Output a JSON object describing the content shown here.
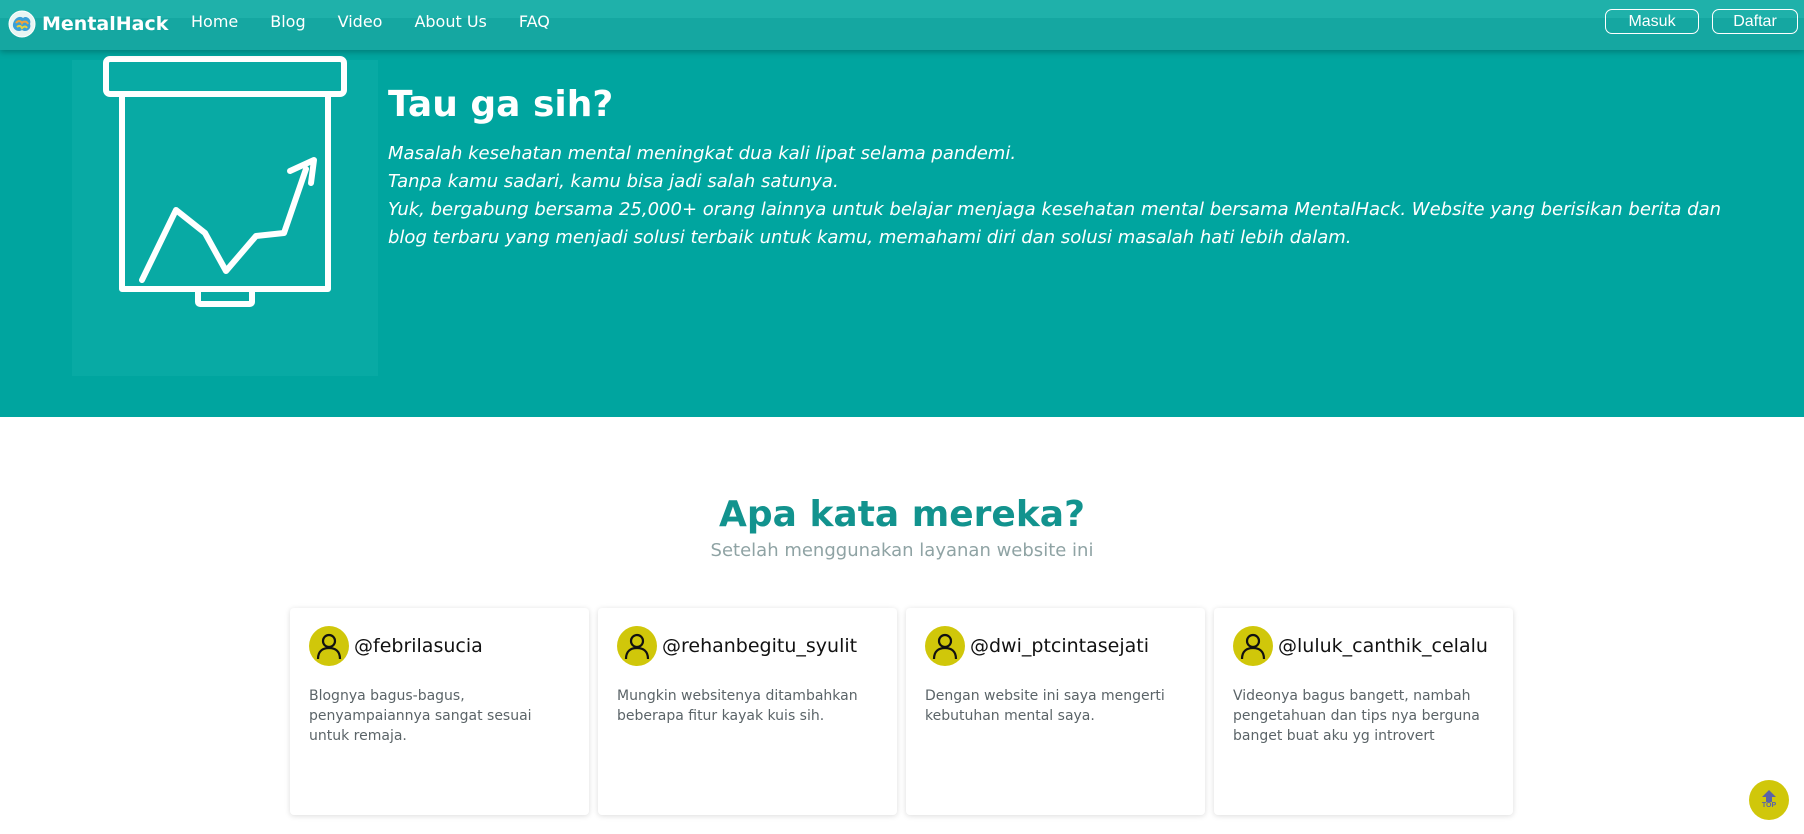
{
  "navbar": {
    "brand": "MentalHack",
    "links": [
      {
        "label": "Home"
      },
      {
        "label": "Blog"
      },
      {
        "label": "Video"
      },
      {
        "label": "About Us"
      },
      {
        "label": "FAQ"
      }
    ],
    "login_label": "Masuk",
    "register_label": "Daftar",
    "color": "#15a7a1"
  },
  "hero": {
    "icon": "presentation-chart-icon",
    "title": "Tau ga sih?",
    "lines": [
      "Masalah kesehatan mental meningkat dua kali lipat selama pandemi.",
      "Tanpa kamu sadari, kamu bisa jadi salah satunya.",
      "Yuk, bergabung bersama 25,000+ orang lainnya untuk belajar menjaga kesehatan mental bersama MentalHack. Website yang berisikan berita dan blog terbaru yang menjadi solusi terbaik untuk kamu, memahami diri dan solusi masalah hati lebih dalam."
    ],
    "color": "#00a59f"
  },
  "testimonials": {
    "title": "Apa kata mereka?",
    "subtitle": "Setelah menggunakan layanan website ini",
    "items": [
      {
        "user": "@febrilasucia",
        "text": "Blognya bagus-bagus, penyampaiannya sangat sesuai untuk remaja."
      },
      {
        "user": "@rehanbegitu_syulit",
        "text": "Mungkin websitenya ditambahkan beberapa fitur kayak kuis sih."
      },
      {
        "user": "@dwi_ptcintasejati",
        "text": "Dengan website ini saya mengerti kebutuhan mental saya."
      },
      {
        "user": "@luluk_canthik_celalu",
        "text": "Videonya bagus bangett, nambah pengetahuan dan tips nya berguna banget buat aku yg introvert"
      }
    ],
    "accent": "#d0c70a"
  },
  "scroll_top": {
    "label": "TOP",
    "icon": "arrow-up-icon"
  }
}
